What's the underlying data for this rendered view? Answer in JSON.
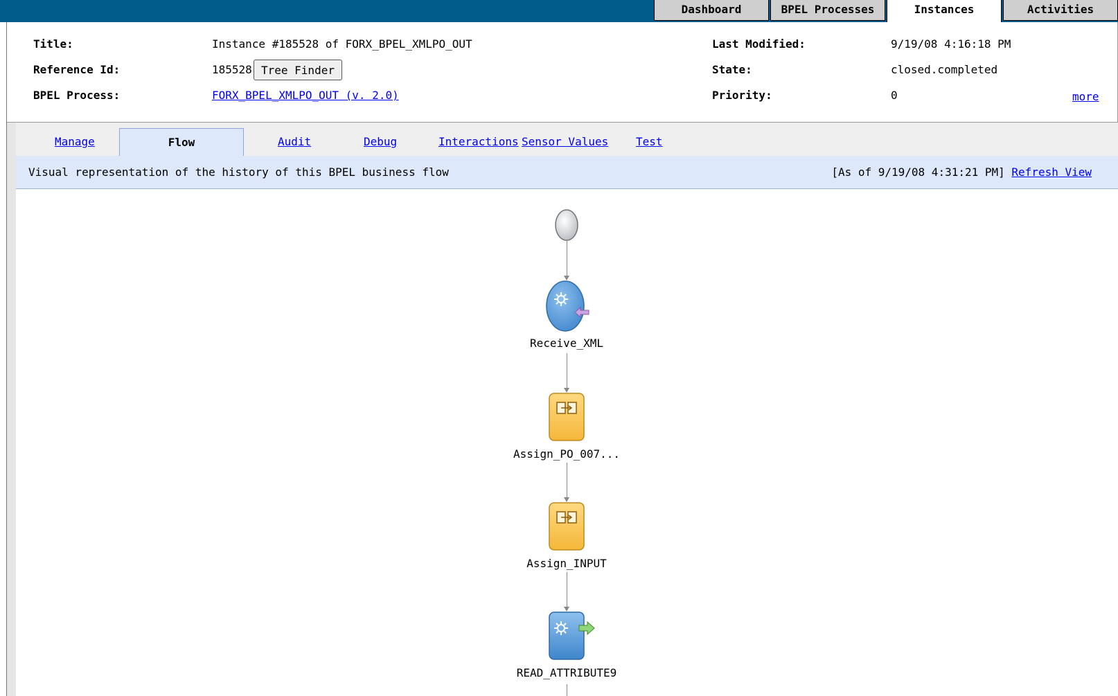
{
  "top_nav": {
    "tabs": [
      {
        "label": "Dashboard"
      },
      {
        "label": "BPEL Processes"
      },
      {
        "label": "Instances"
      },
      {
        "label": "Activities"
      }
    ],
    "active": "Instances"
  },
  "instance": {
    "title_label": "Title:",
    "title_value": "Instance #185528 of FORX_BPEL_XMLPO_OUT",
    "refid_label": "Reference Id:",
    "refid_value": "185528",
    "tree_finder_button": "Tree Finder",
    "process_label": "BPEL Process:",
    "process_link": "FORX_BPEL_XMLPO_OUT (v. 2.0)",
    "modified_label": "Last Modified:",
    "modified_value": "9/19/08 4:16:18 PM",
    "state_label": "State:",
    "state_value": "closed.completed",
    "priority_label": "Priority:",
    "priority_value": "0",
    "more_link": "more"
  },
  "sub_tabs": {
    "manage": "Manage",
    "flow": "Flow",
    "audit": "Audit",
    "debug": "Debug",
    "interactions": "Interactions",
    "sensor_values": "Sensor Values",
    "test": "Test",
    "active": "Flow"
  },
  "description": {
    "text": "Visual representation of the history of this BPEL business flow",
    "as_of": "[As of 9/19/08 4:31:21 PM]",
    "refresh_link": "Refresh View"
  },
  "flow": {
    "nodes": [
      {
        "label": "Receive_XML",
        "icon": "receive-icon"
      },
      {
        "label": "Assign_PO_007...",
        "icon": "assign-icon"
      },
      {
        "label": "Assign_INPUT",
        "icon": "assign-icon"
      },
      {
        "label": "READ_ATTRIBUTE9",
        "icon": "invoke-icon"
      }
    ]
  },
  "colors": {
    "top_bar": "#005a8a",
    "tab_highlight": "#dde9fa",
    "link": "#0000ee"
  }
}
